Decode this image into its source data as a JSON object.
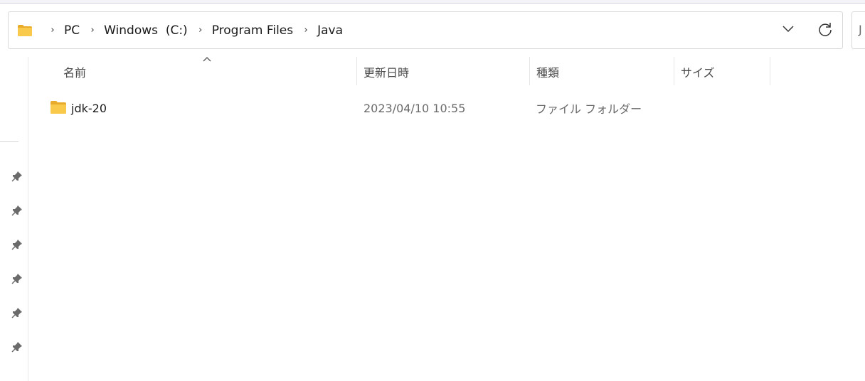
{
  "address_bar": {
    "crumbs": [
      "PC",
      "Windows  (C:)",
      "Program Files",
      "Java"
    ],
    "separator": "›"
  },
  "search": {
    "text": "J"
  },
  "columns": {
    "name": "名前",
    "date": "更新日時",
    "type": "種類",
    "size": "サイズ"
  },
  "files": [
    {
      "name": "jdk-20",
      "date": "2023/04/10 10:55",
      "type": "ファイル フォルダー",
      "size": ""
    }
  ],
  "icons": {
    "address_folder": "folder-icon",
    "dropdown": "chevron-down-icon",
    "refresh": "refresh-icon",
    "pins": [
      "pin-icon",
      "pin-icon",
      "pin-icon",
      "pin-icon",
      "pin-icon",
      "pin-icon"
    ],
    "row_folder": "folder-icon",
    "sort": "sort-ascending-icon"
  },
  "colors": {
    "folder_fill": "#f8c94a",
    "folder_back": "#e9ab2b",
    "border": "#d9d9d9",
    "muted_text": "#6a6a6a"
  }
}
